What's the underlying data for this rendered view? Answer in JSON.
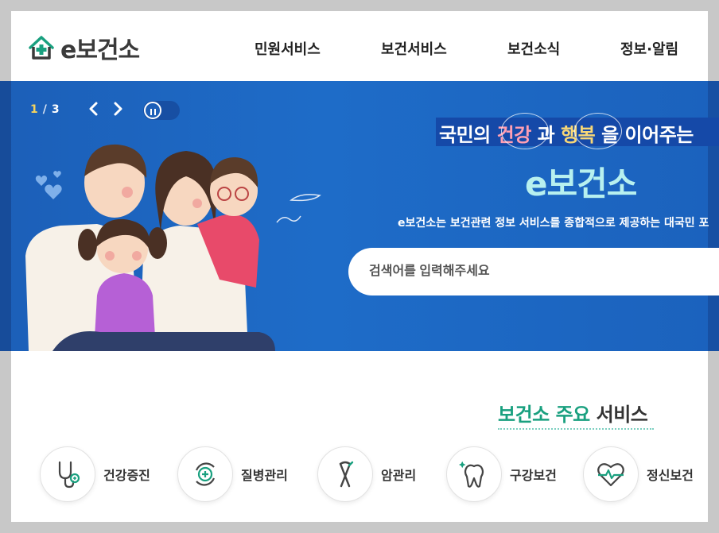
{
  "header": {
    "logo_text": "e보건소",
    "nav": [
      "민원서비스",
      "보건서비스",
      "보건소식",
      "정보·알림"
    ]
  },
  "hero": {
    "pager": {
      "current": "1",
      "separator": "/",
      "total": "3"
    },
    "headline": {
      "pre": "국민의 ",
      "word1": "건강",
      "mid": " 과 ",
      "word2": "행복",
      "post": " 을 이어주는"
    },
    "brand": "e보건소",
    "subtitle": "e보건소는 보건관련 정보 서비스를 종합적으로 제공하는 대국민 포",
    "search_placeholder": "검색어를 입력해주세요"
  },
  "services": {
    "title_accent": "보건소 주요",
    "title_rest": " 서비스",
    "items": [
      {
        "label": "건강증진",
        "icon": "stethoscope-icon"
      },
      {
        "label": "질병관리",
        "icon": "medical-cross-cycle-icon"
      },
      {
        "label": "암관리",
        "icon": "cancer-ribbon-icon"
      },
      {
        "label": "구강보건",
        "icon": "tooth-icon"
      },
      {
        "label": "정신보건",
        "icon": "heart-pulse-icon"
      }
    ]
  },
  "colors": {
    "hero_blue": "#1c5fb8",
    "accent_green": "#19a07f",
    "accent_yellow": "#f4d35e"
  }
}
